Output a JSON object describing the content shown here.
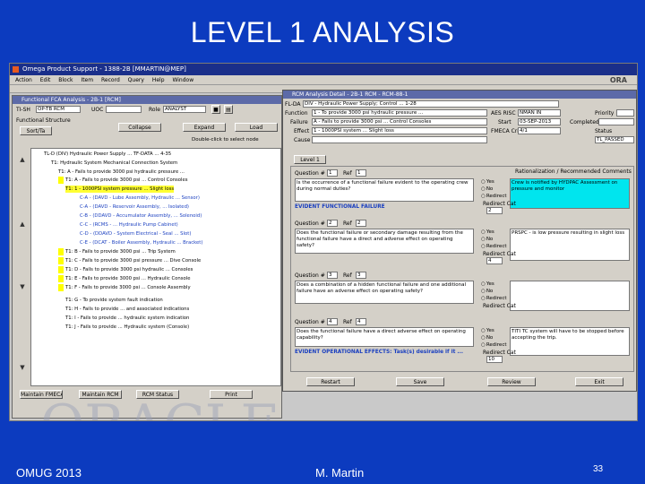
{
  "slide": {
    "title": "LEVEL 1 ANALYSIS",
    "footer_left": "OMUG 2013",
    "footer_center": "M. Martin",
    "page_number": "33"
  },
  "app": {
    "title": "Omega Product Support - 1388-2B [MMARTIN@MEP]",
    "menu": [
      "Action",
      "Edit",
      "Block",
      "Item",
      "Record",
      "Query",
      "Help",
      "Window"
    ],
    "brand": "ORA"
  },
  "fca": {
    "title": "Functional FCA Analysis - 2B-1 [RCM]",
    "item_label": "TI-SH",
    "item_value": "OP-TB RCM",
    "uoc_label": "UOC",
    "role_label": "Role",
    "role_value": "ANALYST",
    "functional_structure": "Functional Structure",
    "sort_btn": "Sort/Ta",
    "buttons": {
      "expand": "Collapse",
      "fca": "Expand",
      "load": "Load"
    },
    "note": "Double-click to select node",
    "tree": [
      "TL-D (DIV)  Hydraulic Power Supply ... TF-DATA ... 4-35",
      "T1: Hydraulic System Mechanical Connection System",
      "T1: A - Fails to provide 3000 psi hydraulic pressure ...",
      "T1: A - Fails to provide 3000 psi ... Control Consoles",
      "T1: 1 - 1000PSI system pressure ... Slight loss",
      "C-A - (DAVD - Lube Assembly, Hydraulic ... Sensor)",
      "C-A - (DAVD - Reservoir Assembly, ... Isolated)",
      "C-B - (DDAVD - Accumulator Assembly, ... Solenoid)",
      "C-C - (RCMS - ... Hydraulic Pump Cabinet)",
      "C-D - (DDAVD - System Electrical - Seal ... Slot)",
      "C-E - (DCAT - Boiler Assembly, Hydraulic ... Bracket)",
      "T1: B - Fails to provide 3000 psi ... Trip System",
      "T1: C - Fails to provide 3000 psi pressure ... Dive Console",
      "T1: D - Fails to provide 3000 psi hydraulic ... Consoles",
      "T1: E - Fails to provide 3000 psi ... Hydraulic Console",
      "T1: F - Fails to provide 3000 psi ... Console Assembly",
      "T1: G - To provide system fault indication",
      "T1: H - Fails to provide ... and associated indications",
      "T1: I - Fails to provide ... hydraulic system indication",
      "T1: J - Fails to provide ... Hydraulic system (Console)"
    ],
    "bottom_buttons": [
      "Maintain FMECA",
      "Maintain RCM",
      "RCM Status",
      "Print"
    ]
  },
  "rcm": {
    "title": "RCM Analysis Detail - 2B-1 RCM - RCM-88-1",
    "fl_label": "FL-DA",
    "fl_value": "DIV - Hydraulic Power Supply; Control ... 1-28",
    "function_label": "Function",
    "function_value": "1 - To provide 3000 psi hydraulic pressure ...",
    "failure_label": "Failure",
    "failure_value": "A - Fails to provide 3000 psi ... Control Consoles",
    "effect_label": "Effect",
    "effect_value": "1 - 1000PSI system ... Slight loss",
    "cause_label": "Cause",
    "aes_label": "AES RISC",
    "aes_value": "NMAN IN",
    "start_label": "Start",
    "start_value": "03-SEP-2013",
    "fmeca_label": "FMECA Crit",
    "fmeca_value": "4/1",
    "priority_label": "Priority",
    "completed_label": "Completed",
    "status_label": "Status",
    "status_value": "TL_PASSED",
    "tab": "Level 1",
    "q_label": "Question #",
    "ref_label": "Ref",
    "ans_header": "Rationalization / Recommended Comments",
    "questions": [
      {
        "no": "1",
        "ref": "1",
        "text": "Is the occurrence of a functional failure evident to the operating crew during normal duties?",
        "answer": "Yes",
        "ans_text": "Crew is notified by HYDPAC Assessment on pressure and monitor",
        "cat": "2"
      },
      {
        "no": "2",
        "ref": "2",
        "text": "Does the functional failure or secondary damage resulting from the functional failure have a direct and adverse effect on operating safety?",
        "answer": "No",
        "ans_text": "PRSPC - is low pressure resulting in slight loss",
        "cat": "4"
      },
      {
        "no": "3",
        "ref": "3",
        "text": "Does a combination of a hidden functional failure and one additional failure have an adverse effect on operating safety?",
        "answer": "",
        "ans_text": "",
        "cat": ""
      },
      {
        "no": "4",
        "ref": "4",
        "text": "Does the functional failure have a direct adverse effect on operating capability?",
        "answer": "Yes",
        "ans_text": "TITI TC system will have to be stopped before accepting the trip.",
        "cat": "10"
      }
    ],
    "evident_text": "EVIDENT FUNCTIONAL FAILURE",
    "evident_ops_text": "EVIDENT OPERATIONAL EFFECTS: Task(s) desirable if it ...",
    "options": [
      "Yes",
      "No",
      "Redirect"
    ],
    "cat_label": "Redirect Cat",
    "buttons": {
      "restart": "Restart",
      "save": "Save",
      "review": "Review",
      "exit": "Exit"
    }
  }
}
